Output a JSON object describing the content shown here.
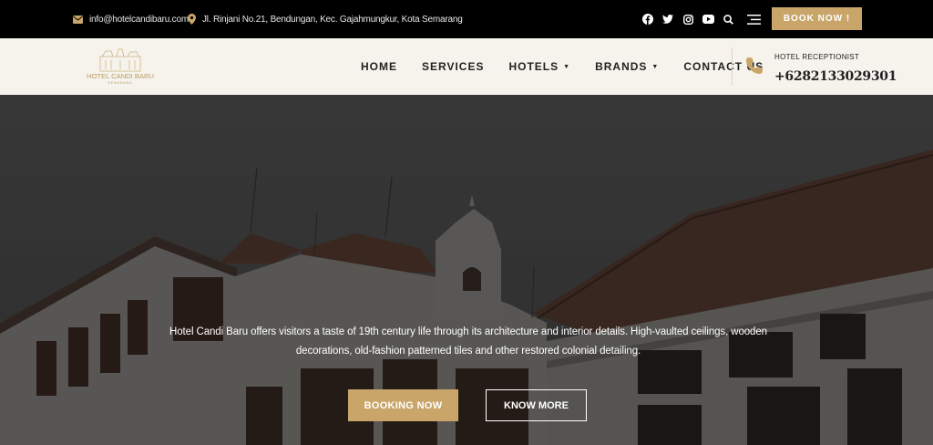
{
  "topbar": {
    "email": "info@hotelcandibaru.com",
    "address": "Jl. Rinjani No.21, Bendungan, Kec. Gajahmungkur, Kota Semarang",
    "social_icons": [
      "facebook-icon",
      "twitter-icon",
      "instagram-icon",
      "youtube-icon"
    ],
    "book_now_label": "BOOK NOW !"
  },
  "logo": {
    "name": "HOTEL CANDI BARU",
    "sub": "SEMARANG"
  },
  "nav": {
    "items": [
      {
        "label": "HOME"
      },
      {
        "label": "SERVICES"
      },
      {
        "label": "HOTELS"
      },
      {
        "label": "BRANDS"
      },
      {
        "label": "CONTACT US"
      }
    ]
  },
  "contact": {
    "label": "HOTEL RECEPTIONIST",
    "phone": "+6282133029301"
  },
  "hero": {
    "text": "Hotel Candi Baru offers visitors a taste of 19th century life through its architecture and interior details. High-vaulted ceilings, wooden decorations, old-fashion patterned tiles and other restored colonial detailing.",
    "booking_label": "BOOKING NOW",
    "know_more_label": "KNOW MORE"
  },
  "colors": {
    "accent": "#c9a56a",
    "topbar_bg": "#000000",
    "nav_bg": "#f6f2ec"
  }
}
